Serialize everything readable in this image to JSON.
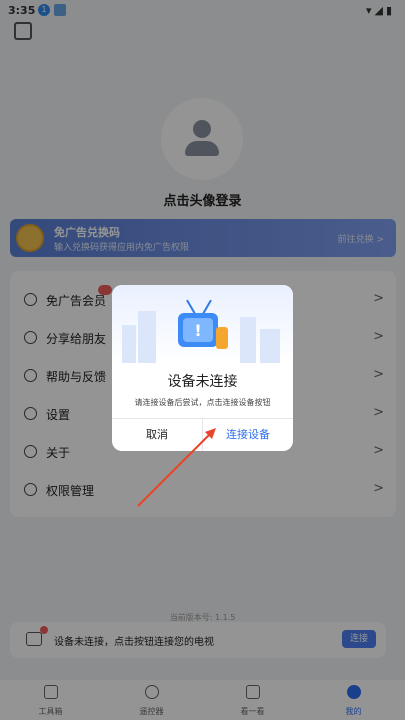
{
  "status_bar": {
    "time": "3:35",
    "notif_badge": "1"
  },
  "profile": {
    "login_prompt": "点击头像登录"
  },
  "ad_banner": {
    "title": "免广告兑换码",
    "subtitle": "输入兑换码获得应用内免广告权限",
    "link": "前往兑换 >"
  },
  "menu": {
    "items": [
      {
        "label": "免广告会员",
        "icon": "vip-icon"
      },
      {
        "label": "分享给朋友",
        "icon": "share-icon"
      },
      {
        "label": "帮助与反馈",
        "icon": "help-icon"
      },
      {
        "label": "设置",
        "icon": "settings-icon"
      },
      {
        "label": "关于",
        "icon": "info-icon"
      },
      {
        "label": "权限管理",
        "icon": "permission-icon"
      }
    ],
    "chevron": ">"
  },
  "version": "当前版本号: 1.1.5",
  "connect_bar": {
    "message": "设备未连接，点击按钮连接您的电视",
    "button": "连接"
  },
  "tabbar": {
    "items": [
      {
        "label": "工具箱",
        "icon": "toolbox-icon"
      },
      {
        "label": "遥控器",
        "icon": "remote-icon"
      },
      {
        "label": "看一看",
        "icon": "watch-icon"
      },
      {
        "label": "我的",
        "icon": "profile-icon",
        "active": true
      }
    ]
  },
  "dialog": {
    "title": "设备未连接",
    "message": "请连接设备后尝试，点击连接设备按钮",
    "cancel": "取消",
    "confirm": "连接设备",
    "tv_glyph": "!"
  },
  "colors": {
    "accent": "#2d6ff0",
    "banner": "#5b7fd6",
    "arrow": "#e8452c"
  }
}
